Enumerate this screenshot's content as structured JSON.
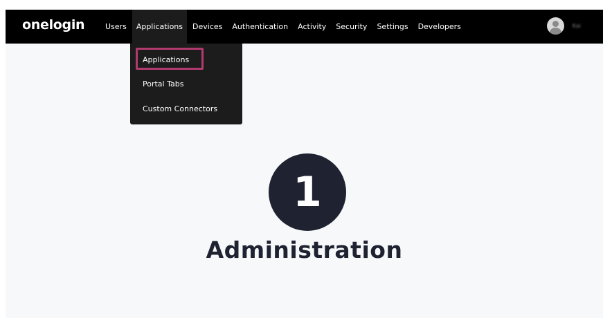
{
  "brand": {
    "logo_text": "onelogin"
  },
  "nav": {
    "items": [
      {
        "label": "Users"
      },
      {
        "label": "Applications"
      },
      {
        "label": "Devices"
      },
      {
        "label": "Authentication"
      },
      {
        "label": "Activity"
      },
      {
        "label": "Security"
      },
      {
        "label": "Settings"
      },
      {
        "label": "Developers"
      }
    ],
    "active": "Applications"
  },
  "user": {
    "name": "Kai"
  },
  "dropdown": {
    "items": [
      {
        "label": "Applications"
      },
      {
        "label": "Portal Tabs"
      },
      {
        "label": "Custom Connectors"
      }
    ],
    "highlighted": "Applications"
  },
  "main": {
    "step_number": "1",
    "headline": "Administration"
  },
  "colors": {
    "topbar": "#000000",
    "dropdown": "#1c1c1c",
    "highlight": "#b13a6e",
    "badge": "#1f2230",
    "page_bg": "#f7f8fa"
  },
  "icons": {
    "avatar": "user-avatar-icon"
  }
}
